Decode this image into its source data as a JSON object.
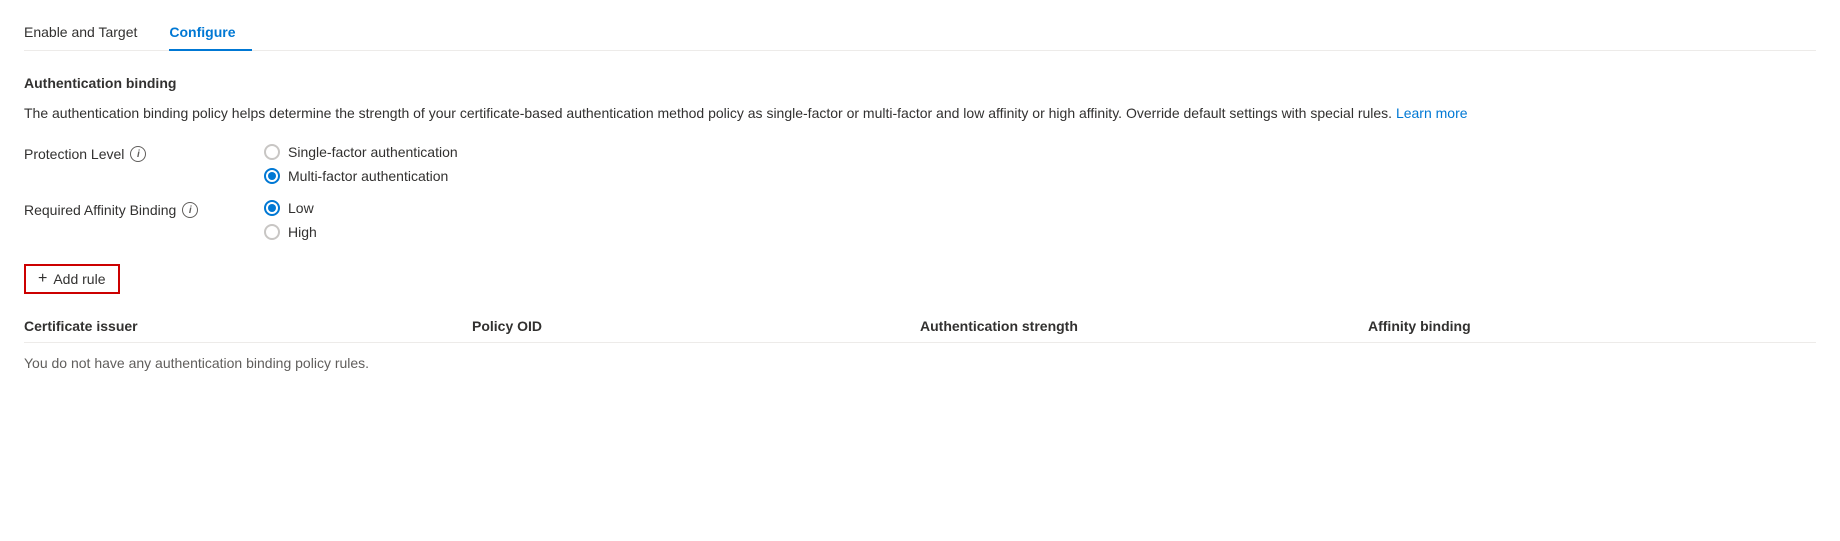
{
  "tabs": [
    {
      "id": "enable-and-target",
      "label": "Enable and Target",
      "active": false
    },
    {
      "id": "configure",
      "label": "Configure",
      "active": true
    }
  ],
  "section": {
    "title": "Authentication binding",
    "description": "The authentication binding policy helps determine the strength of your certificate-based authentication method policy as single-factor or multi-factor and low affinity or high affinity. Override default settings with special rules.",
    "learn_more_label": "Learn more"
  },
  "protection_level": {
    "label": "Protection Level",
    "options": [
      {
        "id": "single-factor",
        "label": "Single-factor authentication",
        "checked": false
      },
      {
        "id": "multi-factor",
        "label": "Multi-factor authentication",
        "checked": true
      }
    ]
  },
  "affinity_binding": {
    "label": "Required Affinity Binding",
    "options": [
      {
        "id": "low",
        "label": "Low",
        "checked": true
      },
      {
        "id": "high",
        "label": "High",
        "checked": false
      }
    ]
  },
  "add_rule_button": {
    "label": "Add rule",
    "plus": "+"
  },
  "table": {
    "columns": [
      {
        "id": "certificate-issuer",
        "label": "Certificate issuer"
      },
      {
        "id": "policy-oid",
        "label": "Policy OID"
      },
      {
        "id": "authentication-strength",
        "label": "Authentication strength"
      },
      {
        "id": "affinity-binding",
        "label": "Affinity binding"
      }
    ],
    "empty_message": "You do not have any authentication binding policy rules."
  }
}
